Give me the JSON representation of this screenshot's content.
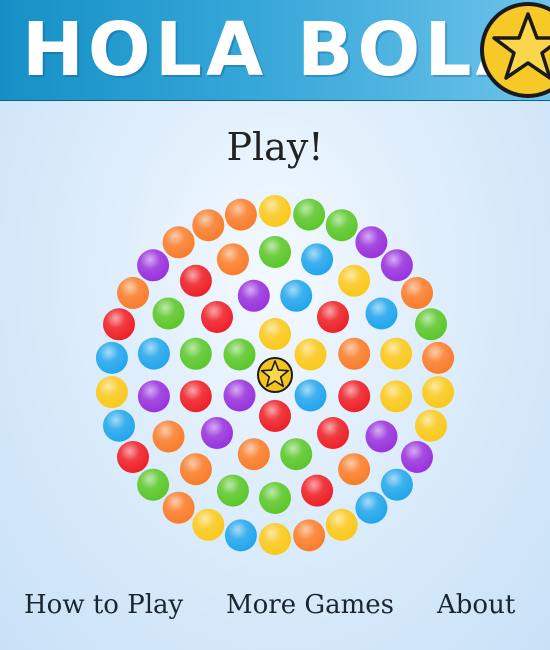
{
  "header": {
    "title": "HOLA BOLA!",
    "logo": "star-ball-icon",
    "colors": {
      "bar_start": "#1590c6",
      "bar_end": "#6dc3ea",
      "star_fill": "#f7c928",
      "star_stroke": "#1a1a1a"
    }
  },
  "play_label": "Play!",
  "nav": {
    "how_to_play": "How to Play",
    "more_games": "More Games",
    "about": "About"
  },
  "ball_colors": {
    "orange": "#f97d2b",
    "yellow": "#f9c91c",
    "green": "#5bc72a",
    "purple": "#9933dd",
    "red": "#ee2027",
    "blue": "#22a6ec"
  },
  "center_piece": "star-icon",
  "rings": [
    [
      "blue",
      "red",
      "purple",
      "green",
      "yellow",
      "yellow"
    ],
    [
      "red",
      "red",
      "green",
      "orange",
      "purple",
      "red",
      "green",
      "red",
      "purple",
      "blue",
      "red",
      "orange"
    ],
    [
      "yellow",
      "purple",
      "orange",
      "red",
      "green",
      "green",
      "orange",
      "orange",
      "purple",
      "blue",
      "green",
      "red",
      "orange",
      "green",
      "blue",
      "yellow",
      "blue",
      "yellow"
    ],
    [
      "yellow",
      "yellow",
      "purple",
      "blue",
      "blue",
      "yellow",
      "orange",
      "yellow",
      "blue",
      "yellow",
      "orange",
      "green",
      "red",
      "blue",
      "yellow",
      "blue",
      "red",
      "orange",
      "purple",
      "orange",
      "orange",
      "orange",
      "yellow",
      "green",
      "green",
      "purple",
      "purple",
      "orange",
      "green",
      "orange"
    ]
  ]
}
